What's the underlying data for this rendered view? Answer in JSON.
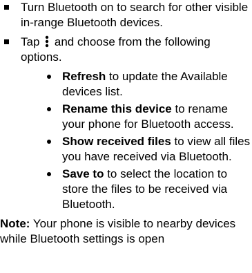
{
  "items": [
    {
      "text": "Turn Bluetooth on to search for other visible in-range Bluetooth devices."
    },
    {
      "before_icon": "Tap",
      "icon": "more-vertical-icon",
      "after_icon": "and choose from the following options.",
      "sub_items": [
        {
          "bold": "Refresh",
          "rest": " to update the Available devices list."
        },
        {
          "bold": "Rename this device",
          "rest": " to rename your phone for Bluetooth access."
        },
        {
          "bold": "Show received files",
          "rest": " to view all files you have received via Bluetooth."
        },
        {
          "bold": "Save to",
          "rest": " to select the location to store the files to be received via Bluetooth."
        }
      ]
    }
  ],
  "note": {
    "label": "Note:",
    "text": " Your phone is visible to nearby devices while Bluetooth settings is open"
  }
}
